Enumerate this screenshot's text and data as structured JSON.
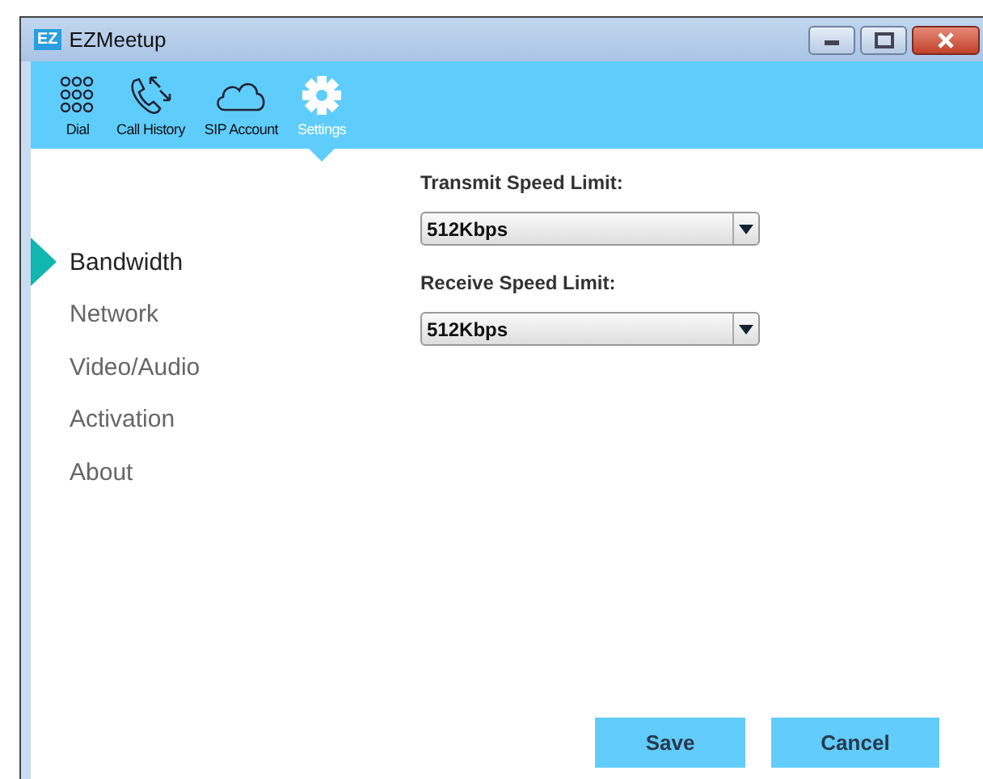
{
  "window": {
    "title": "EZMeetup",
    "logo": "EZ"
  },
  "toolbar": [
    {
      "label": "Dial",
      "kind": "dial",
      "selected": false
    },
    {
      "label": "Call History",
      "kind": "history",
      "selected": false
    },
    {
      "label": "SIP Account",
      "kind": "cloud",
      "selected": false
    },
    {
      "label": "Settings",
      "kind": "gear",
      "selected": true
    }
  ],
  "sidebar": {
    "items": [
      {
        "label": "Bandwidth",
        "selected": true
      },
      {
        "label": "Network",
        "selected": false
      },
      {
        "label": "Video/Audio",
        "selected": false
      },
      {
        "label": "Activation",
        "selected": false
      },
      {
        "label": "About",
        "selected": false
      }
    ]
  },
  "fields": [
    {
      "label": "Transmit Speed Limit:",
      "value": "512Kbps"
    },
    {
      "label": "Receive Speed Limit:",
      "value": "512Kbps"
    }
  ],
  "buttons": [
    "Save",
    "Cancel"
  ]
}
